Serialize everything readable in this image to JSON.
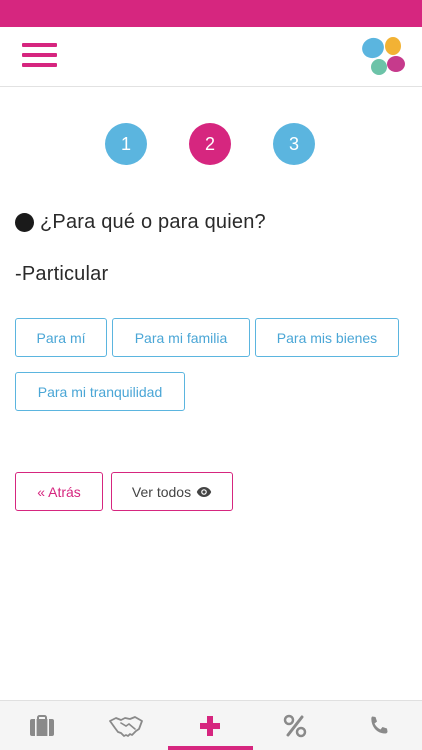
{
  "colors": {
    "brand": "#d6267f",
    "accent": "#5bb5df"
  },
  "header": {
    "menu_icon": "hamburger-menu-icon",
    "logo_icon": "app-logo-icon"
  },
  "steps": [
    {
      "label": "1",
      "active": false
    },
    {
      "label": "2",
      "active": true
    },
    {
      "label": "3",
      "active": false
    }
  ],
  "question": {
    "text": "¿Para qué o para quien?"
  },
  "category": {
    "text": "-Particular"
  },
  "options": [
    {
      "label": "Para mí"
    },
    {
      "label": "Para mi familia"
    },
    {
      "label": "Para mis bienes"
    },
    {
      "label": "Para mi tranquilidad"
    }
  ],
  "actions": {
    "back_label": "« Atrás",
    "view_all_label": "Ver todos"
  },
  "bottom_nav": [
    {
      "icon": "briefcase-icon"
    },
    {
      "icon": "handshake-icon"
    },
    {
      "icon": "plus-icon",
      "active": true
    },
    {
      "icon": "percent-icon"
    },
    {
      "icon": "phone-icon"
    }
  ]
}
